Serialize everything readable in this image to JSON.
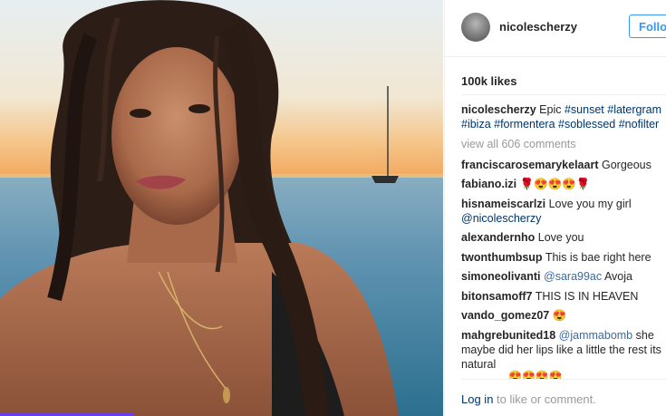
{
  "post": {
    "username": "nicolescherzy",
    "follow_label": "Follow",
    "likes": "100k likes",
    "caption": {
      "username": "nicolescherzy",
      "text": "Epic",
      "hashtags_line1": "#sunset #latergram",
      "hashtags_line2": "#ibiza #formentera #soblessed #nofilter"
    },
    "view_all": "view all 606 comments",
    "comments": [
      {
        "user": "franciscarosemarykelaart",
        "text": "Gorgeous"
      },
      {
        "user": "fabiano.izi",
        "text": "🌹😍😍😍🌹"
      },
      {
        "user": "hisnameiscarlzi",
        "text": "Love you my girl",
        "mention": "@nicolescherzy"
      },
      {
        "user": "alexandernho",
        "text": "Love you"
      },
      {
        "user": "twonthumbsup",
        "text": "This is bae right here"
      },
      {
        "user": "simoneolivanti",
        "mention": "@sara99ac",
        "text": "Avoja"
      },
      {
        "user": "bitonsamoff7",
        "text": "THIS IS IN HEAVEN"
      },
      {
        "user": "vando_gomez07",
        "text": "😍"
      },
      {
        "user": "mahgrebunited18",
        "mention": "@jammabomb",
        "text": "she maybe did her lips like a little the rest its natural"
      }
    ],
    "faded_row": "😍😍😍😍",
    "login_link": "Log in",
    "login_rest": "to like or comment."
  },
  "colors": {
    "link_blue": "#003569",
    "follow_blue": "#3897f0",
    "muted": "#999999"
  },
  "icons": {
    "avatar": "profile-photo"
  }
}
